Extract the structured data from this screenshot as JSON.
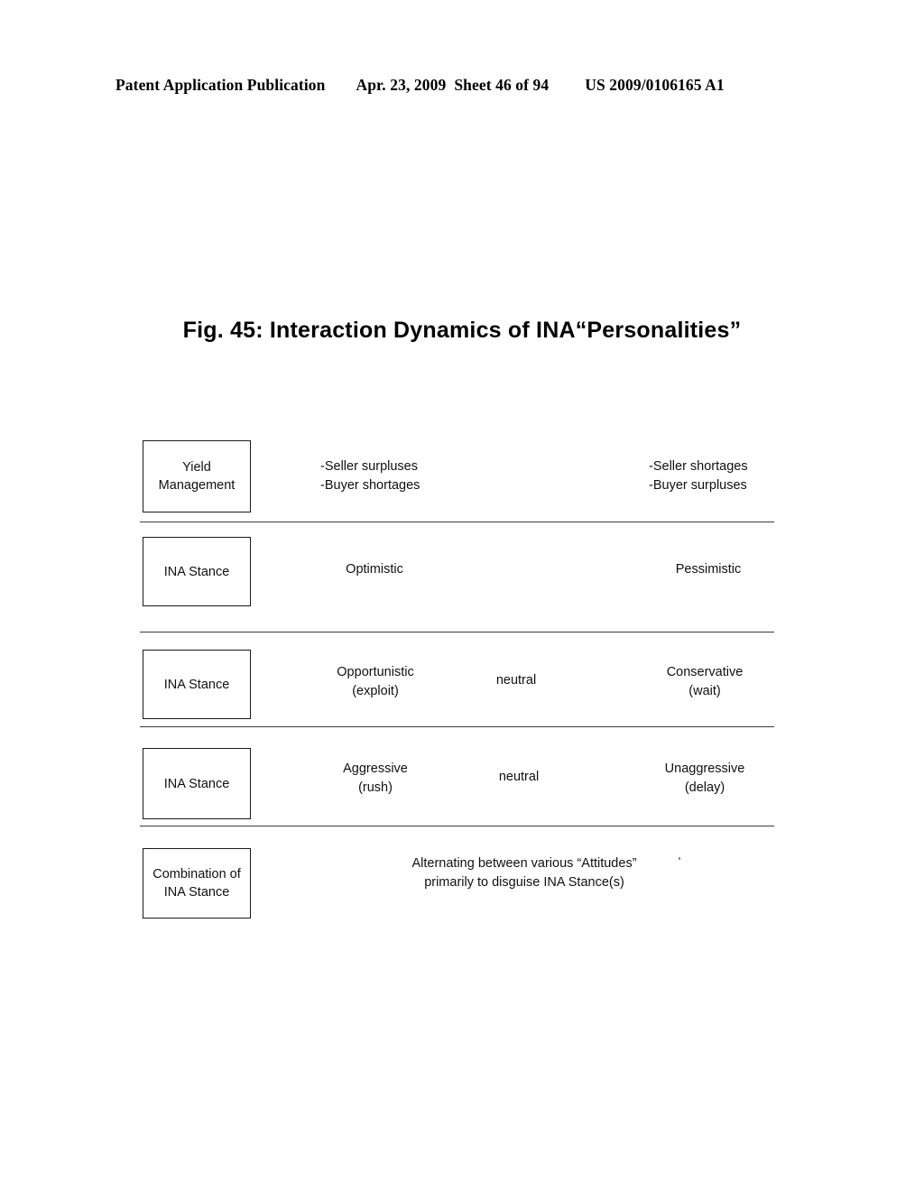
{
  "header": {
    "publication": "Patent Application Publication",
    "date": "Apr. 23, 2009",
    "sheet": "Sheet 46 of 94",
    "patent_number": "US 2009/0106165 A1"
  },
  "figure": {
    "title": "Fig. 45: Interaction Dynamics of INA“Personalities”",
    "number": "45"
  },
  "rows": [
    {
      "box_label": "Yield\nManagement",
      "left_text": "-Seller surpluses\n-Buyer shortages",
      "center_text": "",
      "right_text": "-Seller shortages\n-Buyer surpluses"
    },
    {
      "box_label": "INA Stance",
      "left_text": "Optimistic",
      "center_text": "",
      "right_text": "Pessimistic"
    },
    {
      "box_label": "INA Stance",
      "left_text": "Opportunistic\n(exploit)",
      "center_text": "neutral",
      "right_text": "Conservative\n(wait)"
    },
    {
      "box_label": "INA Stance",
      "left_text": "Aggressive\n(rush)",
      "center_text": "neutral",
      "right_text": "Unaggressive\n(delay)"
    },
    {
      "box_label": "Combination of\nINA Stance",
      "left_text": "",
      "center_text": "Alternating between various “Attitudes”\nprimarily to disguise INA Stance(s)",
      "right_text": ""
    }
  ],
  "colors": {
    "page_background": "#ffffff",
    "ink": "#000000",
    "box_border": "#1a1a1a",
    "separator": "#2b2b2b"
  }
}
